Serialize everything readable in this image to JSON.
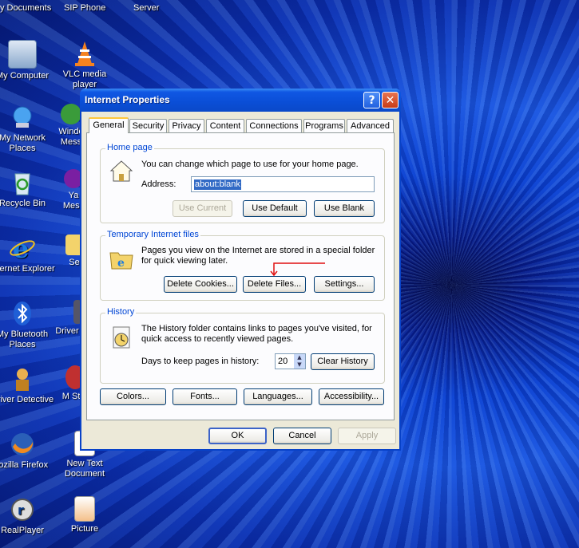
{
  "desktop": {
    "top_labels": [
      "y Documents",
      "SIP Phone",
      "Server"
    ],
    "icons": [
      {
        "label": "My Computer",
        "icon": "computer-icon"
      },
      {
        "label": "VLC media player",
        "icon": "vlc-cone-icon"
      },
      {
        "label": "My Network Places",
        "icon": "network-places-icon"
      },
      {
        "label": "Windo Mess",
        "icon": "messenger-icon"
      },
      {
        "label": "Recycle Bin",
        "icon": "recycle-bin-icon"
      },
      {
        "label": "Ya Mess",
        "icon": "yahoo-messenger-icon"
      },
      {
        "label": "Internet Explorer",
        "icon": "internet-explorer-icon"
      },
      {
        "label": "Se",
        "icon": "folder-icon"
      },
      {
        "label": "My Bluetooth Places",
        "icon": "bluetooth-icon"
      },
      {
        "label": "Driver",
        "icon": "driver-icon"
      },
      {
        "label": "Driver Detective",
        "icon": "driver-detective-icon"
      },
      {
        "label": "M Star",
        "icon": "app-icon"
      },
      {
        "label": "lozilla Firefox",
        "icon": "firefox-icon"
      },
      {
        "label": "New Text Document",
        "icon": "text-document-icon"
      },
      {
        "label": "RealPlayer",
        "icon": "realplayer-icon"
      },
      {
        "label": "Picture",
        "icon": "picture-icon"
      }
    ]
  },
  "dialog": {
    "title": "Internet Properties",
    "help_glyph": "?",
    "close_glyph": "✕",
    "tabs": [
      "General",
      "Security",
      "Privacy",
      "Content",
      "Connections",
      "Programs",
      "Advanced"
    ],
    "active_tab": "General",
    "home_page": {
      "group_title": "Home page",
      "description": "You can change which page to use for your home page.",
      "address_label": "Address:",
      "address_value": "about:blank",
      "use_current": "Use Current",
      "use_default": "Use Default",
      "use_blank": "Use Blank"
    },
    "temp_files": {
      "group_title": "Temporary Internet files",
      "description_line1": "Pages you view on the Internet are stored in a special folder",
      "description_line2": "for quick viewing later.",
      "delete_cookies": "Delete Cookies...",
      "delete_files": "Delete Files...",
      "settings": "Settings..."
    },
    "history": {
      "group_title": "History",
      "description_line1": "The History folder contains links to pages you've visited, for",
      "description_line2": "quick access to recently viewed pages.",
      "days_label": "Days to keep pages in history:",
      "days_value": "20",
      "clear_history": "Clear History"
    },
    "bottom_buttons": {
      "colors": "Colors...",
      "fonts": "Fonts...",
      "languages": "Languages...",
      "accessibility": "Accessibility..."
    },
    "ok": "OK",
    "cancel": "Cancel",
    "apply": "Apply",
    "annotation_color": "#e01010"
  }
}
